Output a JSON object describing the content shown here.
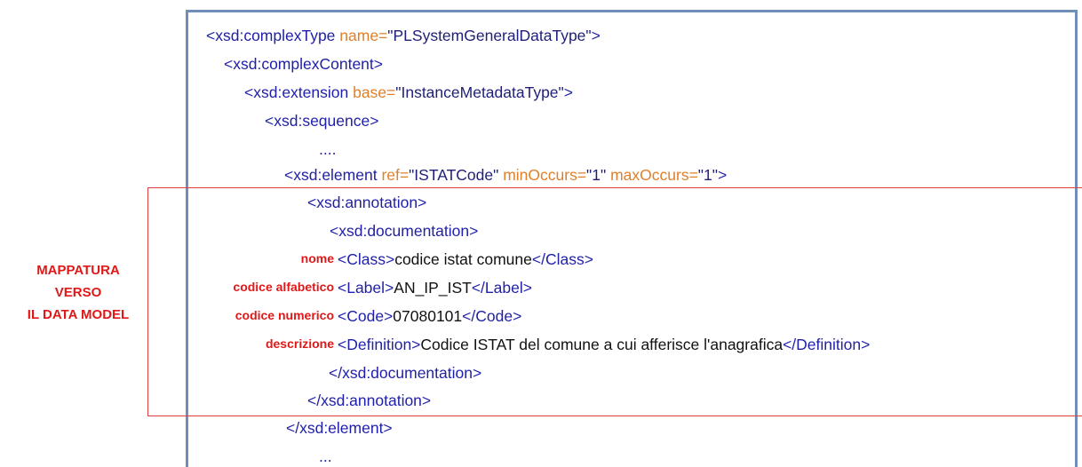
{
  "lines": [
    {
      "segments": [
        {
          "text": "<xsd:complexType",
          "type": "tag"
        },
        {
          "text": " name=",
          "type": "attr"
        },
        {
          "text": "\"PLSystemGeneralDataType\"",
          "type": "val"
        },
        {
          "text": ">",
          "type": "tag"
        }
      ]
    },
    {
      "segments": [
        {
          "text": "<xsd:complexContent>",
          "type": "tag"
        }
      ]
    },
    {
      "segments": [
        {
          "text": "<xsd:extension",
          "type": "tag"
        },
        {
          "text": " base=",
          "type": "attr"
        },
        {
          "text": "\"InstanceMetadataType\"",
          "type": "val"
        },
        {
          "text": ">",
          "type": "tag"
        }
      ]
    },
    {
      "segments": [
        {
          "text": "<xsd:sequence>",
          "type": "tag"
        }
      ]
    },
    {
      "segments": [
        {
          "text": "....",
          "type": "dots"
        }
      ]
    },
    {
      "segments": [
        {
          "text": "<xsd:element",
          "type": "tag"
        },
        {
          "text": " ref=",
          "type": "attr"
        },
        {
          "text": "\"ISTATCode\"",
          "type": "val"
        },
        {
          "text": " minOccurs=",
          "type": "attr"
        },
        {
          "text": "\"1\"",
          "type": "val"
        },
        {
          "text": " maxOccurs=",
          "type": "attr"
        },
        {
          "text": "\"1\"",
          "type": "val"
        },
        {
          "text": ">",
          "type": "tag"
        }
      ]
    },
    {
      "segments": [
        {
          "text": "<xsd:annotation>",
          "type": "tag"
        }
      ]
    },
    {
      "segments": [
        {
          "text": "<xsd:documentation>",
          "type": "tag"
        }
      ]
    },
    {
      "segments": [
        {
          "text": "<Class>",
          "type": "tag"
        },
        {
          "text": "codice istat comune",
          "type": "txt"
        },
        {
          "text": "</Class>",
          "type": "tag"
        }
      ]
    },
    {
      "segments": [
        {
          "text": "<Label>",
          "type": "tag"
        },
        {
          "text": "AN_IP_IST",
          "type": "txt"
        },
        {
          "text": "</Label>",
          "type": "tag"
        }
      ]
    },
    {
      "segments": [
        {
          "text": "<Code>",
          "type": "tag"
        },
        {
          "text": "07080101",
          "type": "txt"
        },
        {
          "text": "</Code>",
          "type": "tag"
        }
      ]
    },
    {
      "segments": [
        {
          "text": "<Definition>",
          "type": "tag"
        },
        {
          "text": "Codice ISTAT del comune a cui afferisce l'anagrafica",
          "type": "txt"
        },
        {
          "text": "</Definition>",
          "type": "tag"
        }
      ]
    },
    {
      "segments": [
        {
          "text": "</xsd:documentation>",
          "type": "tag"
        }
      ]
    },
    {
      "segments": [
        {
          "text": "</xsd:annotation>",
          "type": "tag"
        }
      ]
    },
    {
      "segments": [
        {
          "text": "</xsd:element>",
          "type": "tag"
        }
      ]
    },
    {
      "segments": [
        {
          "text": "...",
          "type": "dots"
        }
      ]
    }
  ],
  "mapping_labels": {
    "nome": "nome",
    "codice_alfabetico": "codice alfabetico",
    "codice_numerico": "codice numerico",
    "descrizione": "descrizione"
  },
  "side_title": {
    "line1": "MAPPATURA",
    "line2": "VERSO",
    "line3": "IL DATA MODEL"
  },
  "colors": {
    "tag": "#1f1fa8",
    "attribute": "#e0802a",
    "value": "#1f1f78",
    "text": "#111111",
    "annotation_red": "#e01818",
    "frame_blue": "#6f8fb9"
  }
}
